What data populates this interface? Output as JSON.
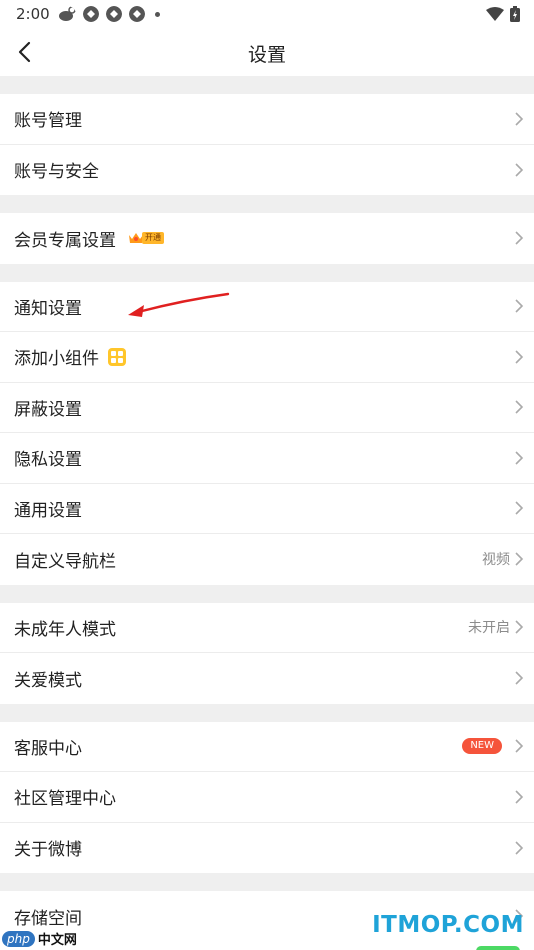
{
  "status_bar": {
    "time": "2:00"
  },
  "nav": {
    "title": "设置"
  },
  "colors": {
    "background_gap": "#efefef",
    "accent_new": "#f5543b",
    "vip_gold": "#ffb62a",
    "annotation_red": "#e02020"
  },
  "sections": [
    {
      "items": [
        {
          "label": "账号管理"
        },
        {
          "label": "账号与安全"
        }
      ]
    },
    {
      "items": [
        {
          "label": "会员专属设置",
          "badge": "开通"
        }
      ]
    },
    {
      "items": [
        {
          "label": "通知设置"
        },
        {
          "label": "添加小组件"
        },
        {
          "label": "屏蔽设置"
        },
        {
          "label": "隐私设置"
        },
        {
          "label": "通用设置"
        },
        {
          "label": "自定义导航栏",
          "value": "视频"
        }
      ]
    },
    {
      "items": [
        {
          "label": "未成年人模式",
          "value": "未开启"
        },
        {
          "label": "关爱模式"
        }
      ]
    },
    {
      "items": [
        {
          "label": "客服中心",
          "badge": "NEW"
        },
        {
          "label": "社区管理中心"
        },
        {
          "label": "关于微博"
        }
      ]
    },
    {
      "items": [
        {
          "label": "存储空间"
        }
      ]
    }
  ],
  "watermark": {
    "left_brand": "php",
    "left_text": "中文网",
    "right_text": "ITMOP.COM"
  }
}
